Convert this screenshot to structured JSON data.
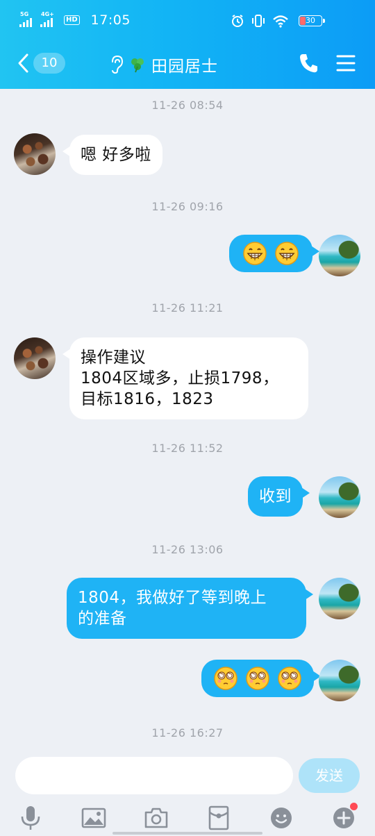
{
  "status_bar": {
    "time": "17:05",
    "signal1_label": "5G",
    "signal2_label": "4G+",
    "hd_label": "HD",
    "battery_level": "30"
  },
  "header": {
    "unread_count": "10",
    "contact_name": "田园居士",
    "name_emoji": "☘️"
  },
  "messages": [
    {
      "type": "time",
      "text": "11-26 08:54"
    },
    {
      "type": "in",
      "text": "嗯 好多啦"
    },
    {
      "type": "time",
      "text": "11-26 09:16"
    },
    {
      "type": "out",
      "emoji": [
        "grin-emoji",
        "grin-emoji"
      ]
    },
    {
      "type": "time",
      "text": "11-26 11:21"
    },
    {
      "type": "in",
      "lines": [
        "操作建议",
        "1804区域多，止损1798，",
        "目标1816，1823"
      ]
    },
    {
      "type": "time",
      "text": "11-26 11:52"
    },
    {
      "type": "out",
      "text": "收到"
    },
    {
      "type": "time",
      "text": "11-26 13:06"
    },
    {
      "type": "out",
      "lines": [
        "1804，我做好了等到晚上",
        "的准备"
      ]
    },
    {
      "type": "out",
      "emoji": [
        "dizzy-emoji",
        "dizzy-emoji",
        "dizzy-emoji"
      ]
    },
    {
      "type": "time",
      "text": "11-26 16:27"
    }
  ],
  "input": {
    "placeholder": "",
    "send_label": "发送"
  },
  "toolbar": [
    "mic-icon",
    "image-icon",
    "camera-icon",
    "red-packet-icon",
    "emoji-icon",
    "plus-icon"
  ],
  "colors": {
    "header_start": "#21c4f2",
    "header_end": "#0c9cf6",
    "outgoing_bubble": "#1fb3f5",
    "incoming_bubble": "#ffffff",
    "background": "#edf0f5",
    "send_button": "#aee3f9"
  }
}
